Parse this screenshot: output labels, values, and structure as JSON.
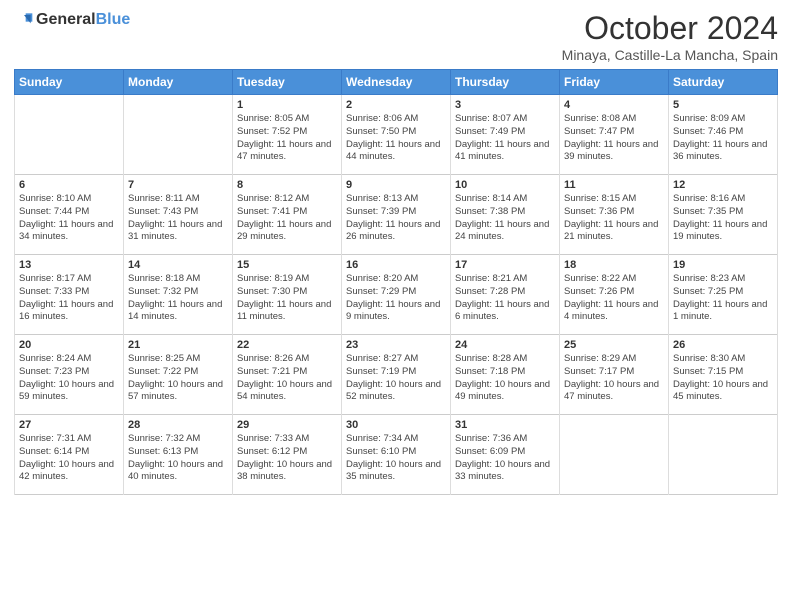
{
  "header": {
    "logo_general": "General",
    "logo_blue": "Blue",
    "month_title": "October 2024",
    "subtitle": "Minaya, Castille-La Mancha, Spain"
  },
  "weekdays": [
    "Sunday",
    "Monday",
    "Tuesday",
    "Wednesday",
    "Thursday",
    "Friday",
    "Saturday"
  ],
  "weeks": [
    [
      {
        "day": "",
        "sunrise": "",
        "sunset": "",
        "daylight": ""
      },
      {
        "day": "",
        "sunrise": "",
        "sunset": "",
        "daylight": ""
      },
      {
        "day": "1",
        "sunrise": "Sunrise: 8:05 AM",
        "sunset": "Sunset: 7:52 PM",
        "daylight": "Daylight: 11 hours and 47 minutes."
      },
      {
        "day": "2",
        "sunrise": "Sunrise: 8:06 AM",
        "sunset": "Sunset: 7:50 PM",
        "daylight": "Daylight: 11 hours and 44 minutes."
      },
      {
        "day": "3",
        "sunrise": "Sunrise: 8:07 AM",
        "sunset": "Sunset: 7:49 PM",
        "daylight": "Daylight: 11 hours and 41 minutes."
      },
      {
        "day": "4",
        "sunrise": "Sunrise: 8:08 AM",
        "sunset": "Sunset: 7:47 PM",
        "daylight": "Daylight: 11 hours and 39 minutes."
      },
      {
        "day": "5",
        "sunrise": "Sunrise: 8:09 AM",
        "sunset": "Sunset: 7:46 PM",
        "daylight": "Daylight: 11 hours and 36 minutes."
      }
    ],
    [
      {
        "day": "6",
        "sunrise": "Sunrise: 8:10 AM",
        "sunset": "Sunset: 7:44 PM",
        "daylight": "Daylight: 11 hours and 34 minutes."
      },
      {
        "day": "7",
        "sunrise": "Sunrise: 8:11 AM",
        "sunset": "Sunset: 7:43 PM",
        "daylight": "Daylight: 11 hours and 31 minutes."
      },
      {
        "day": "8",
        "sunrise": "Sunrise: 8:12 AM",
        "sunset": "Sunset: 7:41 PM",
        "daylight": "Daylight: 11 hours and 29 minutes."
      },
      {
        "day": "9",
        "sunrise": "Sunrise: 8:13 AM",
        "sunset": "Sunset: 7:39 PM",
        "daylight": "Daylight: 11 hours and 26 minutes."
      },
      {
        "day": "10",
        "sunrise": "Sunrise: 8:14 AM",
        "sunset": "Sunset: 7:38 PM",
        "daylight": "Daylight: 11 hours and 24 minutes."
      },
      {
        "day": "11",
        "sunrise": "Sunrise: 8:15 AM",
        "sunset": "Sunset: 7:36 PM",
        "daylight": "Daylight: 11 hours and 21 minutes."
      },
      {
        "day": "12",
        "sunrise": "Sunrise: 8:16 AM",
        "sunset": "Sunset: 7:35 PM",
        "daylight": "Daylight: 11 hours and 19 minutes."
      }
    ],
    [
      {
        "day": "13",
        "sunrise": "Sunrise: 8:17 AM",
        "sunset": "Sunset: 7:33 PM",
        "daylight": "Daylight: 11 hours and 16 minutes."
      },
      {
        "day": "14",
        "sunrise": "Sunrise: 8:18 AM",
        "sunset": "Sunset: 7:32 PM",
        "daylight": "Daylight: 11 hours and 14 minutes."
      },
      {
        "day": "15",
        "sunrise": "Sunrise: 8:19 AM",
        "sunset": "Sunset: 7:30 PM",
        "daylight": "Daylight: 11 hours and 11 minutes."
      },
      {
        "day": "16",
        "sunrise": "Sunrise: 8:20 AM",
        "sunset": "Sunset: 7:29 PM",
        "daylight": "Daylight: 11 hours and 9 minutes."
      },
      {
        "day": "17",
        "sunrise": "Sunrise: 8:21 AM",
        "sunset": "Sunset: 7:28 PM",
        "daylight": "Daylight: 11 hours and 6 minutes."
      },
      {
        "day": "18",
        "sunrise": "Sunrise: 8:22 AM",
        "sunset": "Sunset: 7:26 PM",
        "daylight": "Daylight: 11 hours and 4 minutes."
      },
      {
        "day": "19",
        "sunrise": "Sunrise: 8:23 AM",
        "sunset": "Sunset: 7:25 PM",
        "daylight": "Daylight: 11 hours and 1 minute."
      }
    ],
    [
      {
        "day": "20",
        "sunrise": "Sunrise: 8:24 AM",
        "sunset": "Sunset: 7:23 PM",
        "daylight": "Daylight: 10 hours and 59 minutes."
      },
      {
        "day": "21",
        "sunrise": "Sunrise: 8:25 AM",
        "sunset": "Sunset: 7:22 PM",
        "daylight": "Daylight: 10 hours and 57 minutes."
      },
      {
        "day": "22",
        "sunrise": "Sunrise: 8:26 AM",
        "sunset": "Sunset: 7:21 PM",
        "daylight": "Daylight: 10 hours and 54 minutes."
      },
      {
        "day": "23",
        "sunrise": "Sunrise: 8:27 AM",
        "sunset": "Sunset: 7:19 PM",
        "daylight": "Daylight: 10 hours and 52 minutes."
      },
      {
        "day": "24",
        "sunrise": "Sunrise: 8:28 AM",
        "sunset": "Sunset: 7:18 PM",
        "daylight": "Daylight: 10 hours and 49 minutes."
      },
      {
        "day": "25",
        "sunrise": "Sunrise: 8:29 AM",
        "sunset": "Sunset: 7:17 PM",
        "daylight": "Daylight: 10 hours and 47 minutes."
      },
      {
        "day": "26",
        "sunrise": "Sunrise: 8:30 AM",
        "sunset": "Sunset: 7:15 PM",
        "daylight": "Daylight: 10 hours and 45 minutes."
      }
    ],
    [
      {
        "day": "27",
        "sunrise": "Sunrise: 7:31 AM",
        "sunset": "Sunset: 6:14 PM",
        "daylight": "Daylight: 10 hours and 42 minutes."
      },
      {
        "day": "28",
        "sunrise": "Sunrise: 7:32 AM",
        "sunset": "Sunset: 6:13 PM",
        "daylight": "Daylight: 10 hours and 40 minutes."
      },
      {
        "day": "29",
        "sunrise": "Sunrise: 7:33 AM",
        "sunset": "Sunset: 6:12 PM",
        "daylight": "Daylight: 10 hours and 38 minutes."
      },
      {
        "day": "30",
        "sunrise": "Sunrise: 7:34 AM",
        "sunset": "Sunset: 6:10 PM",
        "daylight": "Daylight: 10 hours and 35 minutes."
      },
      {
        "day": "31",
        "sunrise": "Sunrise: 7:36 AM",
        "sunset": "Sunset: 6:09 PM",
        "daylight": "Daylight: 10 hours and 33 minutes."
      },
      {
        "day": "",
        "sunrise": "",
        "sunset": "",
        "daylight": ""
      },
      {
        "day": "",
        "sunrise": "",
        "sunset": "",
        "daylight": ""
      }
    ]
  ]
}
